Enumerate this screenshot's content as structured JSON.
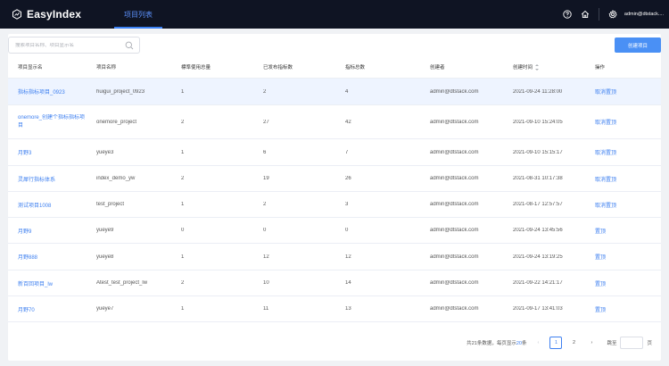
{
  "app": {
    "name": "EasyIndex"
  },
  "nav": {
    "active_tab": "项目列表"
  },
  "header": {
    "user": "admin@dtstack...."
  },
  "search": {
    "placeholder": "搜索项目名称、项目显示名",
    "value": ""
  },
  "toolbar": {
    "create_label": "创建项目"
  },
  "table": {
    "columns": [
      "项目显示名",
      "项目名称",
      "標準使用总量",
      "已发布指标数",
      "指标总数",
      "创建者",
      "创建时间",
      "操作"
    ],
    "rows": [
      {
        "display": "指标指标项目_0923",
        "name": "huigui_project_0923",
        "c3": "1",
        "c4": "2",
        "c5": "4",
        "creator": "admin@dtstack.com",
        "time": "2021-09-24 11:28:00",
        "action": "取消置顶"
      },
      {
        "display": "onemore_创建个指标指标项目",
        "name": "onemore_project",
        "c3": "2",
        "c4": "27",
        "c5": "42",
        "creator": "admin@dtstack.com",
        "time": "2021-09-10 15:24:05",
        "action": "取消置顶"
      },
      {
        "display": "月野3",
        "name": "yueye3",
        "c3": "1",
        "c4": "6",
        "c5": "7",
        "creator": "admin@dtstack.com",
        "time": "2021-09-10 15:15:17",
        "action": "取消置顶"
      },
      {
        "display": "灵犀行指标体系",
        "name": "index_demo_yw",
        "c3": "2",
        "c4": "19",
        "c5": "26",
        "creator": "admin@dtstack.com",
        "time": "2021-08-31 10:17:38",
        "action": "取消置顶"
      },
      {
        "display": "测试项目1008",
        "name": "test_project",
        "c3": "1",
        "c4": "2",
        "c5": "3",
        "creator": "admin@dtstack.com",
        "time": "2021-08-17 12:57:57",
        "action": "取消置顶"
      },
      {
        "display": "月野9",
        "name": "yueye9",
        "c3": "0",
        "c4": "0",
        "c5": "0",
        "creator": "admin@dtstack.com",
        "time": "2021-09-24 13:45:56",
        "action": "置顶"
      },
      {
        "display": "月野888",
        "name": "yueye8",
        "c3": "1",
        "c4": "12",
        "c5": "12",
        "creator": "admin@dtstack.com",
        "time": "2021-09-24 13:19:25",
        "action": "置顶"
      },
      {
        "display": "新百回项目_lw",
        "name": "Atest_test_project_lw",
        "c3": "2",
        "c4": "10",
        "c5": "14",
        "creator": "admin@dtstack.com",
        "time": "2021-09-22 14:21:17",
        "action": "置顶"
      },
      {
        "display": "月野70",
        "name": "yueye7",
        "c3": "1",
        "c4": "11",
        "c5": "13",
        "creator": "admin@dtstack.com",
        "time": "2021-09-17 13:41:03",
        "action": "置顶"
      }
    ]
  },
  "pagination": {
    "total_prefix": "共",
    "total": "21",
    "total_mid": "条数据，每页显示",
    "page_size": "20",
    "total_suffix": "条",
    "pages": [
      "1",
      "2"
    ],
    "jump_label": "跳至",
    "page_unit": "页"
  }
}
